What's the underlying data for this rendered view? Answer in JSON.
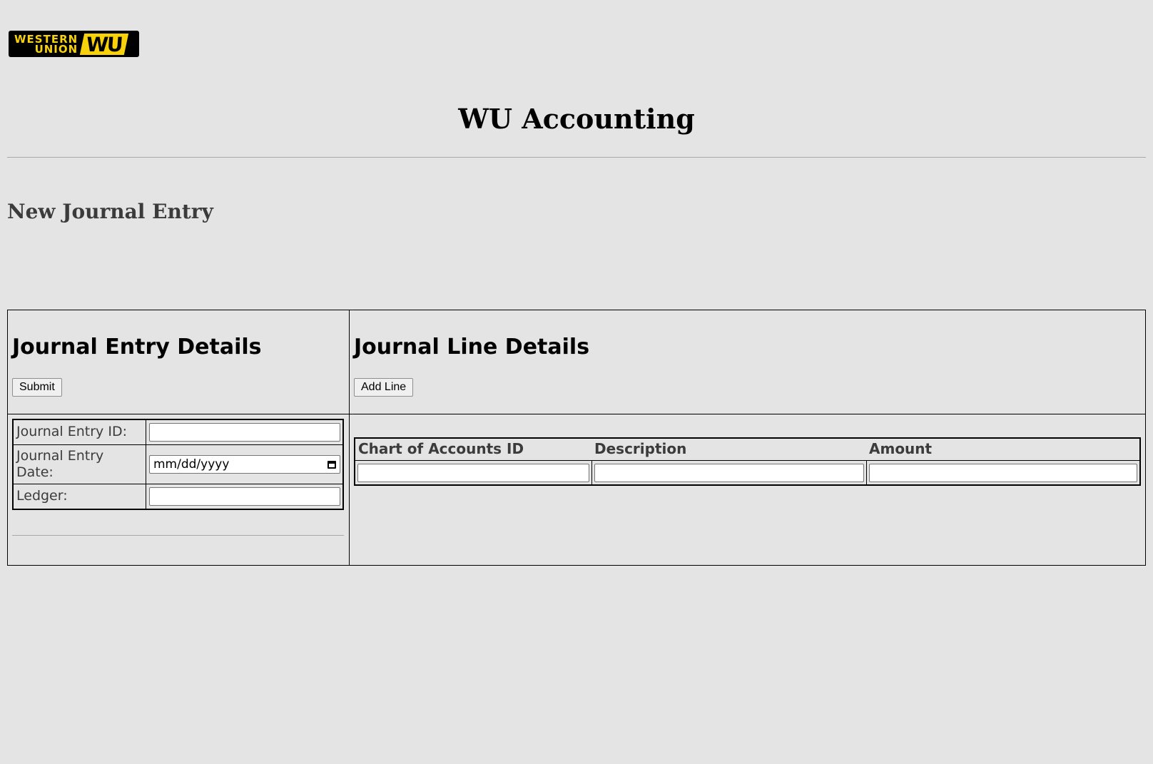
{
  "logo": {
    "line1": "WESTERN",
    "line2": "UNION",
    "mark": "WU",
    "colors": {
      "background": "#000000",
      "brand": "#f7d20a"
    }
  },
  "header": {
    "title": "WU Accounting"
  },
  "section": {
    "title": "New Journal Entry"
  },
  "entry_panel": {
    "heading": "Journal Entry Details",
    "submit_label": "Submit",
    "fields": {
      "id_label": "Journal Entry ID:",
      "id_value": "",
      "date_label": "Journal Entry Date:",
      "date_placeholder": "mm/dd/yyyy",
      "ledger_label": "Ledger:",
      "ledger_value": ""
    }
  },
  "lines_panel": {
    "heading": "Journal Line Details",
    "add_line_label": "Add Line",
    "columns": [
      "Chart of Accounts ID",
      "Description",
      "Amount"
    ],
    "rows": [
      {
        "account_id": "",
        "description": "",
        "amount": ""
      }
    ]
  },
  "icons": {
    "date_picker": "calendar-icon"
  }
}
